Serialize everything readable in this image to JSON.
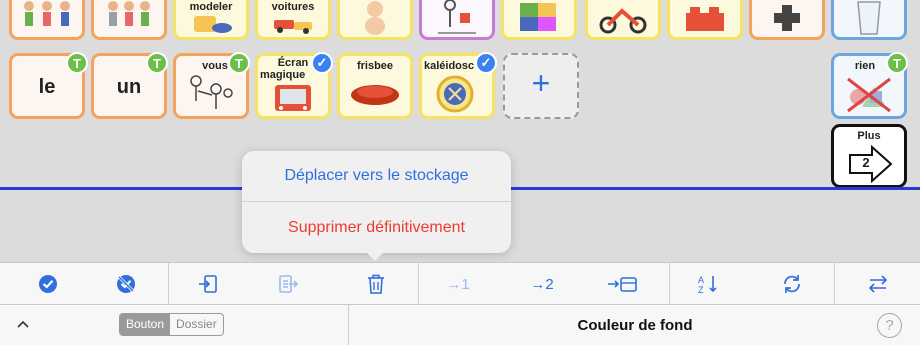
{
  "board": {
    "row1": {
      "modeler": "modeler",
      "voitures": "voitures"
    },
    "row2": {
      "le": "le",
      "un": "un",
      "vous": "vous",
      "ecran_line1": "Écran",
      "ecran_line2": "magique",
      "frisbee": "frisbee",
      "kaleidosc": "kaléidosc",
      "rien": "rien"
    },
    "plus": {
      "label": "Plus",
      "number": "2"
    },
    "badges": {
      "t": "T",
      "check": "✓"
    },
    "add_symbol": "+"
  },
  "popup": {
    "move_label": "Déplacer vers le stockage",
    "delete_label": "Supprimer définitivement"
  },
  "toolbar": {
    "move1": "→1",
    "move2": "→2"
  },
  "bottom": {
    "segment_bouton": "Bouton",
    "segment_dossier": "Dossier",
    "title": "Couleur de fond",
    "help": "?"
  },
  "colors": {
    "accent": "#2f6fde",
    "destructive": "#ef3a2e",
    "badge_green": "#6cbf4a",
    "badge_blue": "#3b82f0",
    "divider_line": "#2b3bd1"
  }
}
